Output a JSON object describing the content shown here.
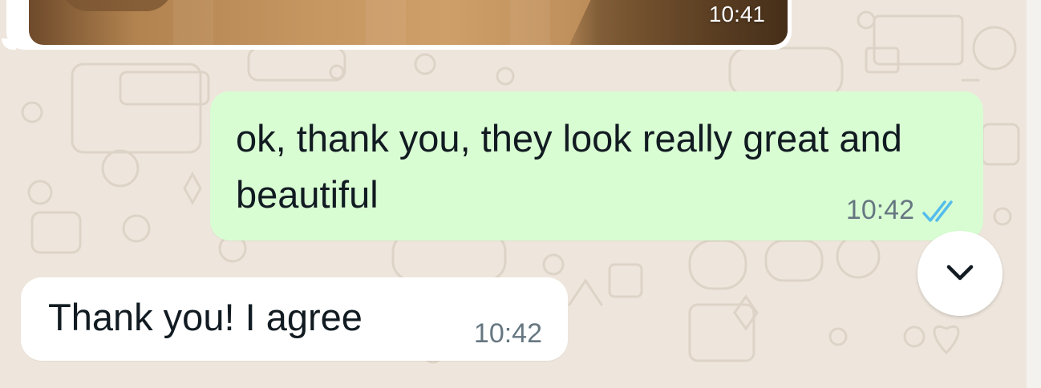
{
  "chat": {
    "messages": [
      {
        "direction": "incoming",
        "type": "image",
        "time": "10:41"
      },
      {
        "direction": "outgoing",
        "type": "text",
        "text": "ok, thank you, they look really great and beautiful",
        "time": "10:42",
        "status_icon": "double-check-read-icon"
      },
      {
        "direction": "incoming",
        "type": "text",
        "text": "Thank you! I agree",
        "time": "10:42"
      }
    ]
  },
  "scroll_button": {
    "icon": "chevron-down-icon"
  },
  "colors": {
    "background": "#eee6dc",
    "outgoing_bubble": "#d9fdd3",
    "incoming_bubble": "#ffffff",
    "meta_text": "#667781",
    "read_check": "#53bdeb",
    "body_text": "#111b21"
  }
}
